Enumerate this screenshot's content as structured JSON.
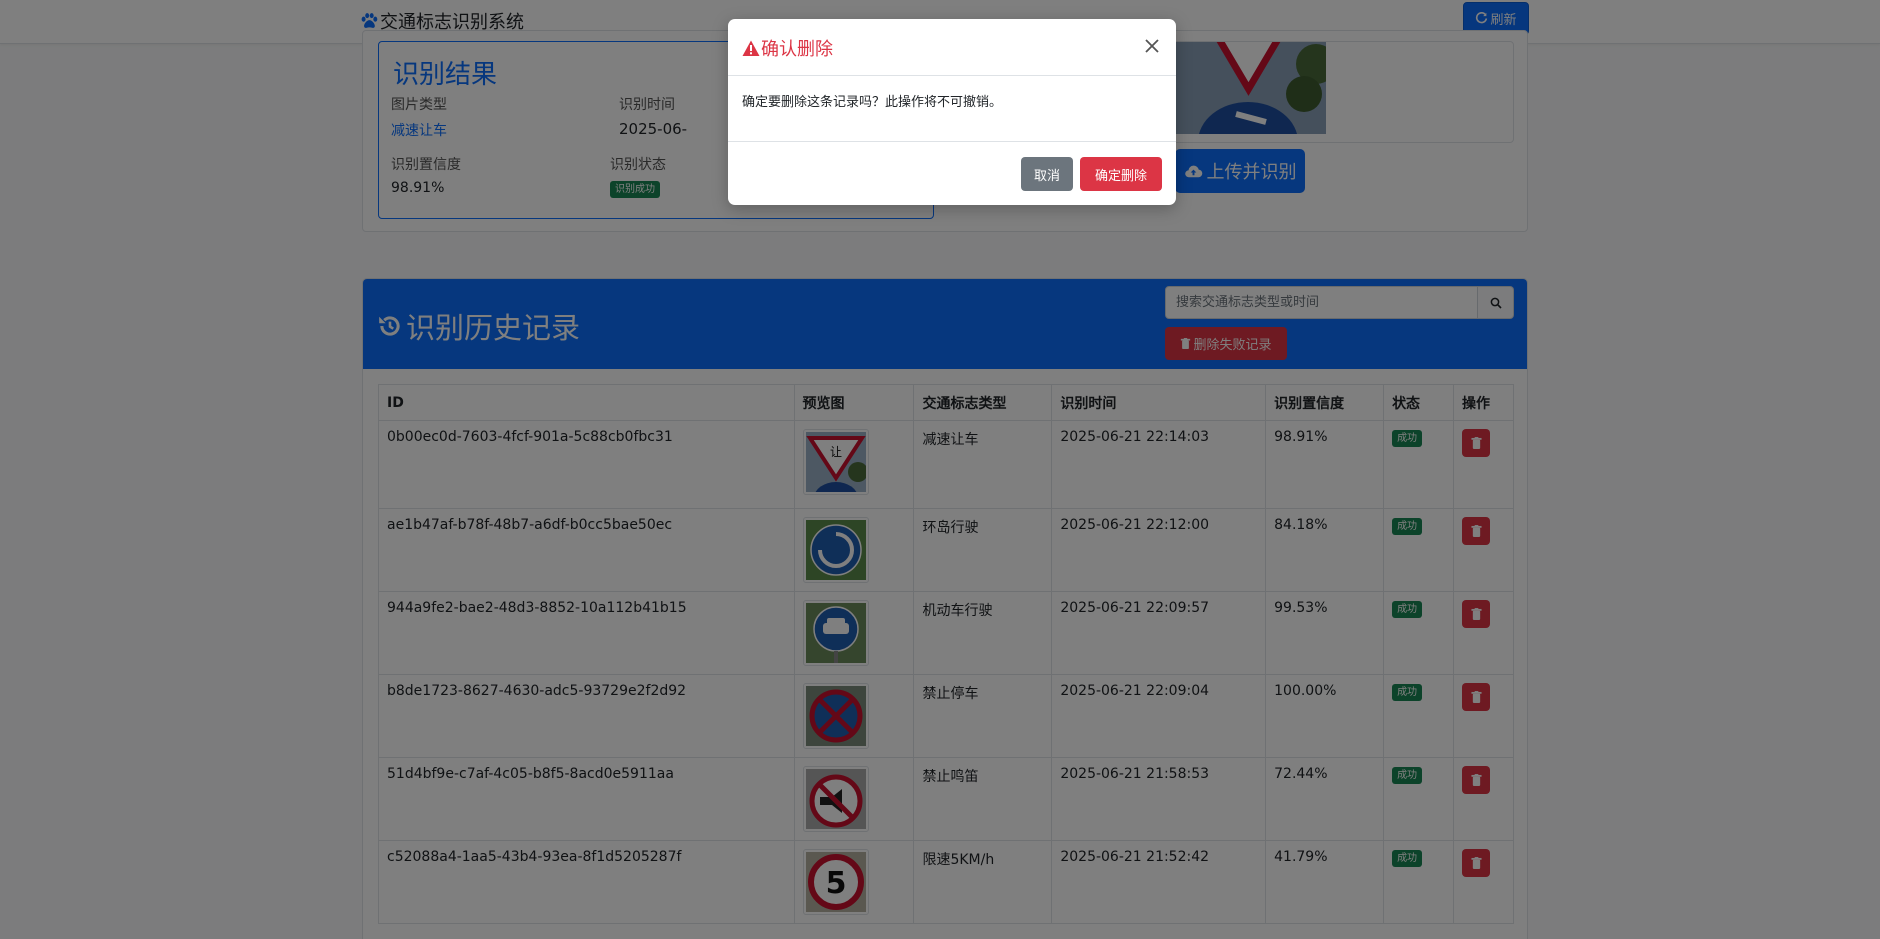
{
  "navbar": {
    "brand": "交通标志识别系统",
    "refresh_label": "刷新"
  },
  "result": {
    "title": "识别结果",
    "type_label": "图片类型",
    "type_value": "减速让车",
    "time_label": "识别时间",
    "time_value": "2025-06-",
    "confidence_label": "识别置信度",
    "confidence_value": "98.91%",
    "status_label": "识别状态",
    "status_value": "识别成功",
    "upload_label": "上传并识别"
  },
  "history": {
    "title": "识别历史记录",
    "search_placeholder": "搜索交通标志类型或时间",
    "delete_failed_label": "删除失败记录",
    "columns": [
      "ID",
      "预览图",
      "交通标志类型",
      "识别时间",
      "识别置信度",
      "状态",
      "操作"
    ],
    "rows": [
      {
        "id": "0b00ec0d-7603-4fcf-901a-5c88cb0fbc31",
        "type": "减速让车",
        "time": "2025-06-21 22:14:03",
        "confidence": "98.91%",
        "status": "成功",
        "thumb": "yield-sign-icon"
      },
      {
        "id": "ae1b47af-b78f-48b7-a6df-b0cc5bae50ec",
        "type": "环岛行驶",
        "time": "2025-06-21 22:12:00",
        "confidence": "84.18%",
        "status": "成功",
        "thumb": "roundabout-sign-icon"
      },
      {
        "id": "944a9fe2-bae2-48d3-8852-10a112b41b15",
        "type": "机动车行驶",
        "time": "2025-06-21 22:09:57",
        "confidence": "99.53%",
        "status": "成功",
        "thumb": "motor-vehicle-sign-icon"
      },
      {
        "id": "b8de1723-8627-4630-adc5-93729e2f2d92",
        "type": "禁止停车",
        "time": "2025-06-21 22:09:04",
        "confidence": "100.00%",
        "status": "成功",
        "thumb": "no-parking-sign-icon"
      },
      {
        "id": "51d4bf9e-c7af-4c05-b8f5-8acd0e5911aa",
        "type": "禁止鸣笛",
        "time": "2025-06-21 21:58:53",
        "confidence": "72.44%",
        "status": "成功",
        "thumb": "no-honking-sign-icon"
      },
      {
        "id": "c52088a4-1aa5-43b4-93ea-8f1d5205287f",
        "type": "限速5KM/h",
        "time": "2025-06-21 21:52:42",
        "confidence": "41.79%",
        "status": "成功",
        "thumb": "speed-limit-sign-icon"
      }
    ]
  },
  "modal": {
    "title": "确认删除",
    "body": "确定要删除这条记录吗？此操作将不可撤销。",
    "cancel_label": "取消",
    "confirm_label": "确定删除"
  },
  "sign_text": {
    "yield": "让",
    "speed": "5"
  },
  "colors": {
    "primary": "#0d6efd",
    "danger": "#dc3545",
    "success": "#198754",
    "secondary": "#6c757d"
  }
}
